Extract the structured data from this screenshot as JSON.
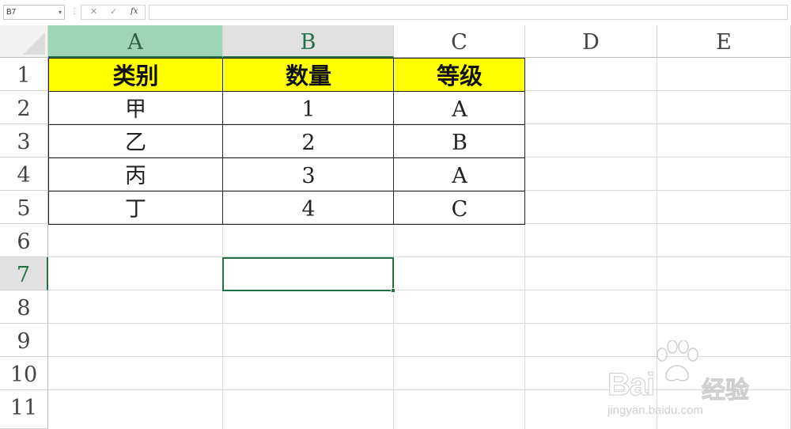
{
  "formula_bar": {
    "name_box": "B7",
    "cancel_icon": "✕",
    "enter_icon": "✓",
    "function_label": "fx",
    "formula": ""
  },
  "columns": [
    "A",
    "B",
    "C",
    "D",
    "E"
  ],
  "rows": [
    "1",
    "2",
    "3",
    "4",
    "5",
    "6",
    "7",
    "8",
    "9",
    "10",
    "11"
  ],
  "table": {
    "headers": [
      "类别",
      "数量",
      "等级"
    ],
    "data": [
      [
        "甲",
        "1",
        "A"
      ],
      [
        "乙",
        "2",
        "B"
      ],
      [
        "丙",
        "3",
        "A"
      ],
      [
        "丁",
        "4",
        "C"
      ]
    ]
  },
  "active_cell": "B7",
  "colors": {
    "header_fill": "#ffff00",
    "accent": "#217346",
    "selected_col_a": "#9fd5b7"
  },
  "watermark": {
    "brand": "Bai",
    "brand2": "经验",
    "url": "jingyan.baidu.com"
  }
}
